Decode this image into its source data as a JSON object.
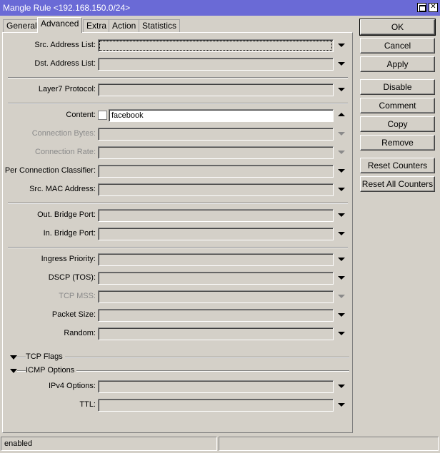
{
  "window": {
    "title": "Mangle Rule <192.168.150.0/24>"
  },
  "titlebar_buttons": {
    "maximize_icon": "maximize-icon",
    "close_glyph": "✕"
  },
  "tabs": [
    {
      "label": "General"
    },
    {
      "label": "Advanced",
      "active": true
    },
    {
      "label": "Extra"
    },
    {
      "label": "Action"
    },
    {
      "label": "Statistics"
    }
  ],
  "fields": {
    "src_address_list": {
      "label": "Src. Address List:",
      "value": ""
    },
    "dst_address_list": {
      "label": "Dst. Address List:",
      "value": ""
    },
    "layer7_protocol": {
      "label": "Layer7 Protocol:",
      "value": ""
    },
    "content": {
      "label": "Content:",
      "value": "facebook",
      "negate": false
    },
    "connection_bytes": {
      "label": "Connection Bytes:",
      "value": "",
      "disabled": true
    },
    "connection_rate": {
      "label": "Connection Rate:",
      "value": "",
      "disabled": true
    },
    "per_connection_classifier": {
      "label": "Per Connection Classifier:",
      "value": ""
    },
    "src_mac_address": {
      "label": "Src. MAC Address:",
      "value": ""
    },
    "out_bridge_port": {
      "label": "Out. Bridge Port:",
      "value": ""
    },
    "in_bridge_port": {
      "label": "In. Bridge Port:",
      "value": ""
    },
    "ingress_priority": {
      "label": "Ingress Priority:",
      "value": ""
    },
    "dscp_tos": {
      "label": "DSCP (TOS):",
      "value": ""
    },
    "tcp_mss": {
      "label": "TCP MSS:",
      "value": "",
      "disabled": true
    },
    "packet_size": {
      "label": "Packet Size:",
      "value": ""
    },
    "random": {
      "label": "Random:",
      "value": ""
    },
    "ipv4_options": {
      "label": "IPv4 Options:",
      "value": ""
    },
    "ttl": {
      "label": "TTL:",
      "value": ""
    }
  },
  "sections": {
    "tcp_flags": {
      "label": "TCP Flags"
    },
    "icmp_options": {
      "label": "ICMP Options"
    }
  },
  "buttons": {
    "ok": "OK",
    "cancel": "Cancel",
    "apply": "Apply",
    "disable": "Disable",
    "comment": "Comment",
    "copy": "Copy",
    "remove": "Remove",
    "reset_counters": "Reset Counters",
    "reset_all_counters": "Reset All Counters"
  },
  "status": {
    "state": "enabled",
    "extra": ""
  }
}
